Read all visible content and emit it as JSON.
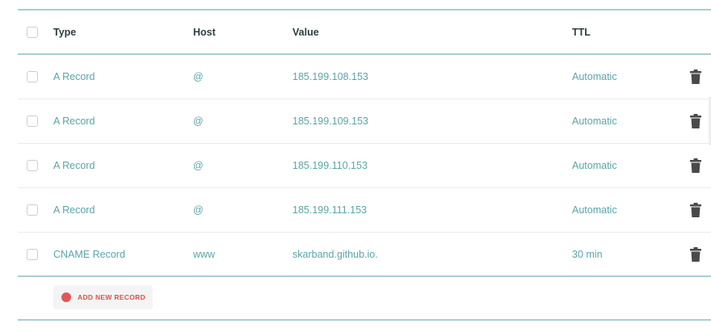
{
  "table": {
    "headers": {
      "type": "Type",
      "host": "Host",
      "value": "Value",
      "ttl": "TTL"
    },
    "rows": [
      {
        "type": "A Record",
        "host": "@",
        "value": "185.199.108.153",
        "ttl": "Automatic"
      },
      {
        "type": "A Record",
        "host": "@",
        "value": "185.199.109.153",
        "ttl": "Automatic"
      },
      {
        "type": "A Record",
        "host": "@",
        "value": "185.199.110.153",
        "ttl": "Automatic"
      },
      {
        "type": "A Record",
        "host": "@",
        "value": "185.199.111.153",
        "ttl": "Automatic"
      },
      {
        "type": "CNAME Record",
        "host": "www",
        "value": "skarband.github.io.",
        "ttl": "30 min"
      }
    ]
  },
  "actions": {
    "add_label": "ADD NEW RECORD"
  },
  "colors": {
    "accent_teal": "#5aa5a8",
    "rule": "#a9cdd0",
    "add_red": "#e25656",
    "trash": "#4a4a4a"
  }
}
